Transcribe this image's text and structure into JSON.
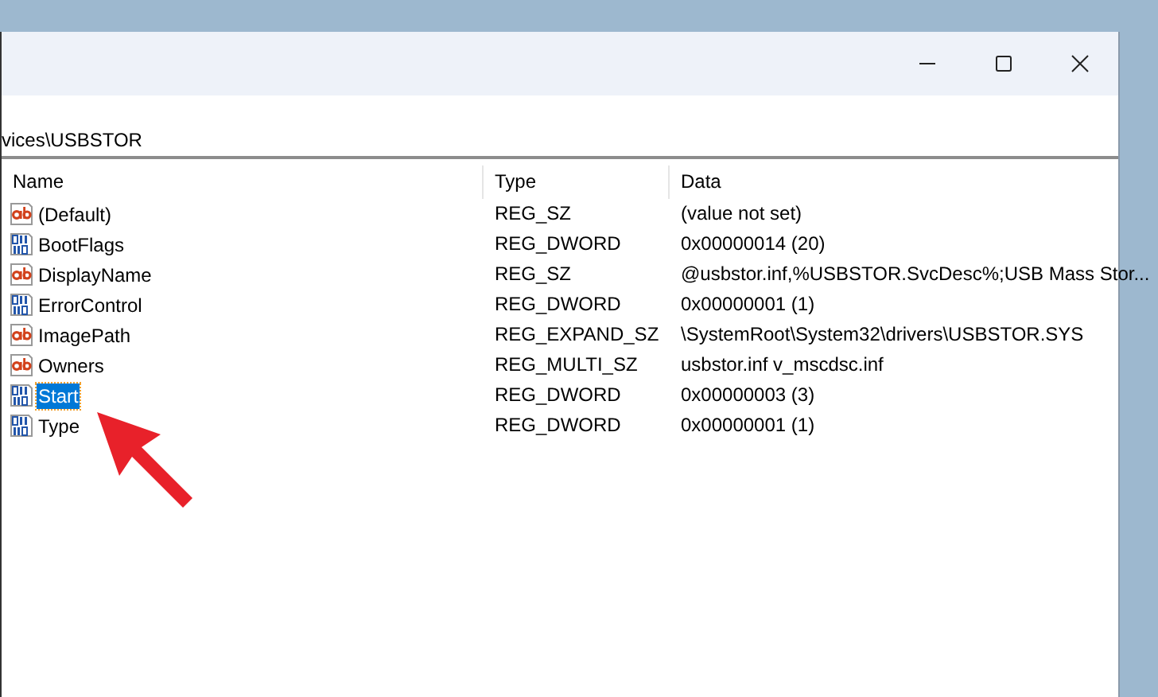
{
  "address": "vices\\USBSTOR",
  "columns": [
    "Name",
    "Type",
    "Data"
  ],
  "rows": [
    {
      "kind": "string",
      "name": "(Default)",
      "type": "REG_SZ",
      "data": "(value not set)",
      "selected": false
    },
    {
      "kind": "binary",
      "name": "BootFlags",
      "type": "REG_DWORD",
      "data": "0x00000014 (20)",
      "selected": false
    },
    {
      "kind": "string",
      "name": "DisplayName",
      "type": "REG_SZ",
      "data": "@usbstor.inf,%USBSTOR.SvcDesc%;USB Mass Stor...",
      "selected": false
    },
    {
      "kind": "binary",
      "name": "ErrorControl",
      "type": "REG_DWORD",
      "data": "0x00000001 (1)",
      "selected": false
    },
    {
      "kind": "string",
      "name": "ImagePath",
      "type": "REG_EXPAND_SZ",
      "data": "\\SystemRoot\\System32\\drivers\\USBSTOR.SYS",
      "selected": false
    },
    {
      "kind": "string",
      "name": "Owners",
      "type": "REG_MULTI_SZ",
      "data": "usbstor.inf v_mscdsc.inf",
      "selected": false
    },
    {
      "kind": "binary",
      "name": "Start",
      "type": "REG_DWORD",
      "data": "0x00000003 (3)",
      "selected": true
    },
    {
      "kind": "binary",
      "name": "Type",
      "type": "REG_DWORD",
      "data": "0x00000001 (1)",
      "selected": false
    }
  ]
}
